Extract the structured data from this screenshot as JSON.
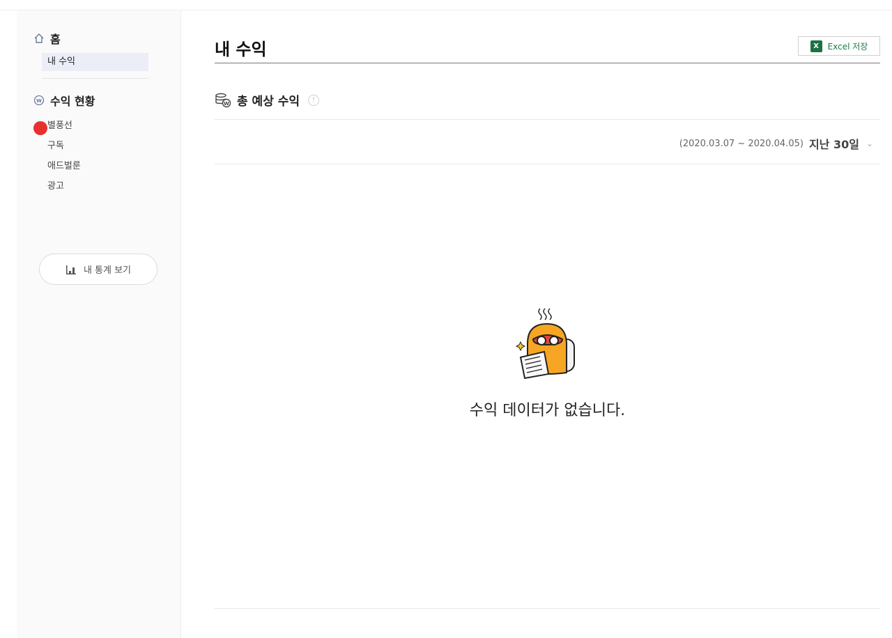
{
  "sidebar": {
    "home_label": "홈",
    "home_active_item": "내 수익",
    "revenue_section": "수익 현황",
    "revenue_items": [
      "별풍선",
      "구독",
      "애드벌룬",
      "광고"
    ],
    "stats_button": "내 통계 보기"
  },
  "main": {
    "page_title": "내 수익",
    "excel_button": "Excel 저장",
    "excel_icon_letter": "X",
    "section_title": "총 예상 수익",
    "info_icon": "!",
    "date_range": "(2020.03.07 ~ 2020.04.05)",
    "period": "지난 30일",
    "empty_message": "수익 데이터가 없습니다."
  },
  "colors": {
    "accent": "#1e7145",
    "active_bg": "#ebeef7",
    "red_dot": "#e8302f",
    "character": "#f6a623"
  }
}
